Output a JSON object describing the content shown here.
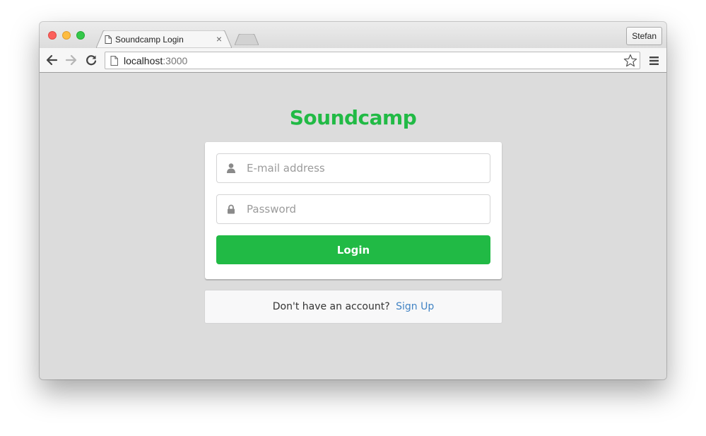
{
  "browser": {
    "tab_title": "Soundcamp Login",
    "tab_close": "×",
    "profile_name": "Stefan",
    "url_host": "localhost",
    "url_port": ":3000"
  },
  "page": {
    "brand": "Soundcamp",
    "email_placeholder": "E-mail address",
    "password_placeholder": "Password",
    "login_label": "Login",
    "signup_prompt": "Don't have an account?",
    "signup_link": "Sign Up"
  },
  "colors": {
    "brand_green": "#21ba45",
    "link_blue": "#4183c4",
    "page_background": "#dcdcdc"
  },
  "icons": {
    "email_field": "user-icon",
    "password_field": "lock-icon"
  }
}
